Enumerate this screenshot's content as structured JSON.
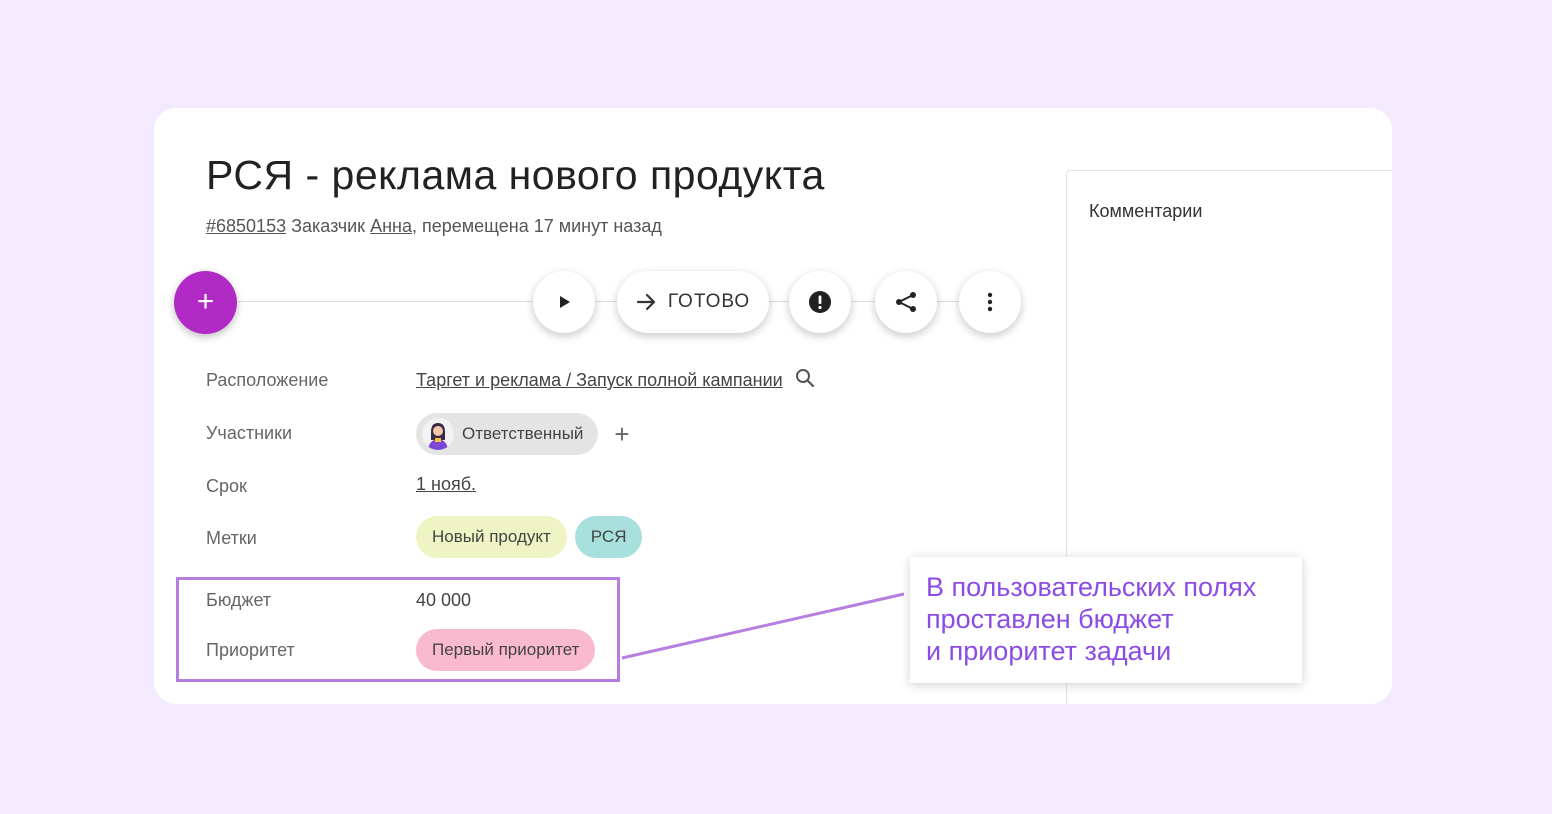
{
  "task": {
    "title": "РСЯ - реклама нового продукта",
    "id": "#6850153",
    "customer_prefix": "Заказчик",
    "customer_name": "Анна",
    "moved_text": ", перемещена 17 минут назад"
  },
  "toolbar": {
    "add_symbol": "+",
    "done_label": "ГОТОВО"
  },
  "fields": {
    "location": {
      "label": "Расположение",
      "value": "Таргет и реклама / Запуск полной кампании"
    },
    "participants": {
      "label": "Участники",
      "chip": "Ответственный",
      "add_symbol": "+"
    },
    "deadline": {
      "label": "Срок",
      "value": "1 нояб."
    },
    "tags": {
      "label": "Метки",
      "items": [
        "Новый продукт",
        "РСЯ"
      ]
    },
    "budget": {
      "label": "Бюджет",
      "value": "40 000"
    },
    "priority": {
      "label": "Приоритет",
      "value": "Первый приоритет"
    }
  },
  "comments": {
    "title": "Комментарии"
  },
  "callout": {
    "lines": [
      "В пользовательских полях",
      "проставлен бюджет",
      "и приоритет задачи"
    ]
  },
  "colors": {
    "background": "#f3ebfd",
    "fab": "#b22ac6",
    "accent_text": "#8b4ce6",
    "highlight_border": "#b57ee0",
    "tag_green": "#eef4c3",
    "tag_teal": "#a8e0de",
    "tag_pink": "#f9b9cf"
  },
  "icons": {
    "play": "play-icon",
    "arrow": "arrow-right-icon",
    "alert": "alert-circle-icon",
    "share": "share-icon",
    "more": "more-vertical-icon",
    "search": "search-icon"
  }
}
